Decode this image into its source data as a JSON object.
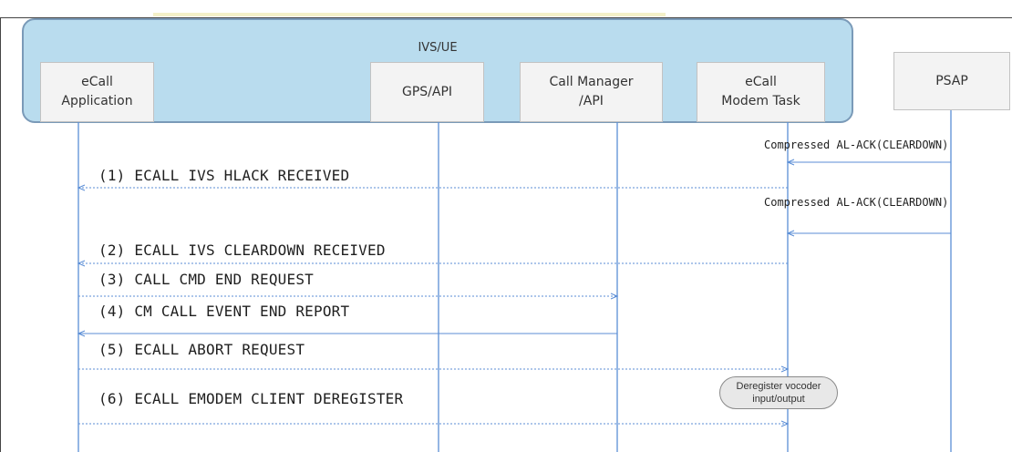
{
  "group": {
    "label": "IVS/UE"
  },
  "entities": [
    {
      "id": "ecall-app",
      "label": "eCall\nApplication"
    },
    {
      "id": "gps",
      "label": "GPS/API"
    },
    {
      "id": "callmgr",
      "label": "Call Manager\n/API"
    },
    {
      "id": "modem",
      "label": "eCall\nModem Task"
    },
    {
      "id": "psap",
      "label": "PSAP"
    }
  ],
  "psap_messages": [
    {
      "label": "Compressed AL-ACK(CLEARDOWN)"
    },
    {
      "label": "Compressed AL-ACK(CLEARDOWN)"
    }
  ],
  "messages": [
    {
      "label": "(1) ECALL IVS HLACK RECEIVED"
    },
    {
      "label": "(2) ECALL IVS CLEARDOWN RECEIVED"
    },
    {
      "label": "(3) CALL CMD END REQUEST"
    },
    {
      "label": "(4) CM CALL EVENT END REPORT"
    },
    {
      "label": "(5) ECALL ABORT REQUEST"
    },
    {
      "label": "(6) ECALL EMODEM CLIENT DEREGISTER"
    }
  ],
  "note": {
    "label": "Deregister vocoder\ninput/output"
  },
  "colors": {
    "lifeline": "#5b8ed6",
    "group_fill": "#b9dcee",
    "group_border": "#7a9ab8",
    "arrow": "#5b8ed6"
  }
}
